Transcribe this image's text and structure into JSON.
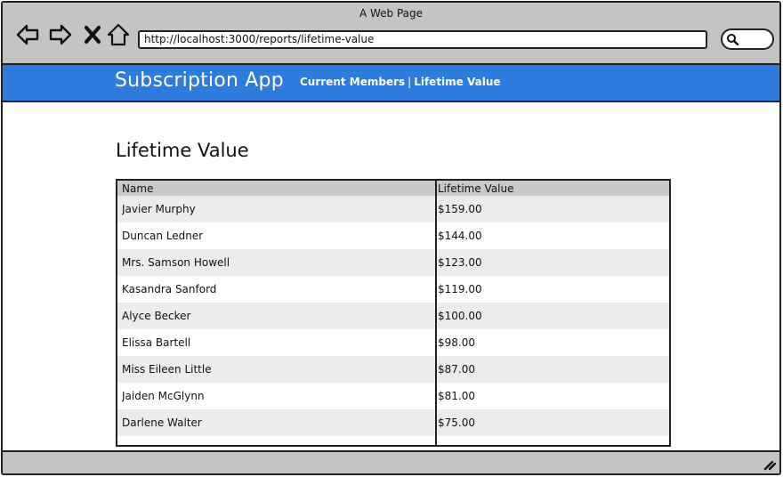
{
  "window": {
    "title": "A Web Page"
  },
  "browser": {
    "url": "http://localhost:3000/reports/lifetime-value",
    "icons": [
      "back-arrow-icon",
      "forward-arrow-icon",
      "close-x-icon",
      "home-icon",
      "search-icon"
    ]
  },
  "header": {
    "brand": "Subscription App",
    "nav": {
      "current_members": "Current Members",
      "separator": "|",
      "lifetime_value": "Lifetime Value"
    },
    "color": "#2f7bdd"
  },
  "main": {
    "title": "Lifetime Value",
    "table": {
      "columns": [
        "Name",
        "Lifetime Value"
      ],
      "rows": [
        [
          "Javier Murphy",
          "$159.00"
        ],
        [
          "Duncan Ledner",
          "$144.00"
        ],
        [
          "Mrs. Samson Howell",
          "$123.00"
        ],
        [
          "Kasandra Sanford",
          "$119.00"
        ],
        [
          "Alyce Becker",
          "$100.00"
        ],
        [
          "Elissa Bartell",
          "$98.00"
        ],
        [
          "Miss Eileen Little",
          "$87.00"
        ],
        [
          "Jaiden McGlynn",
          "$81.00"
        ],
        [
          "Darlene Walter",
          "$75.00"
        ]
      ]
    }
  }
}
